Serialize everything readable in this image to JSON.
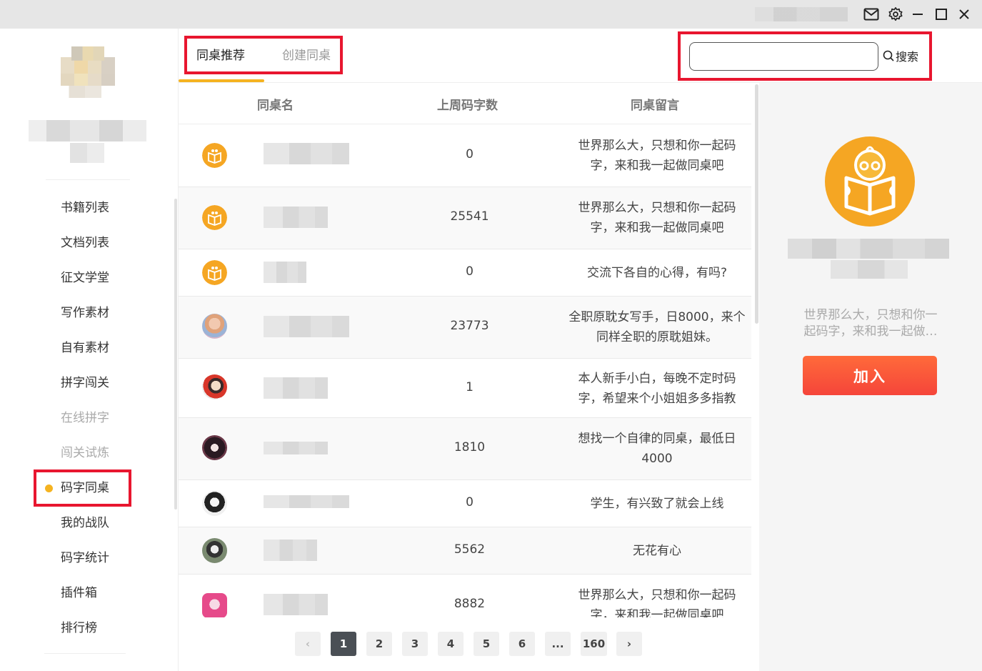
{
  "sidebar": {
    "items": [
      {
        "label": "书籍列表"
      },
      {
        "label": "文档列表"
      },
      {
        "label": "征文学堂"
      },
      {
        "label": "写作素材"
      },
      {
        "label": "自有素材"
      },
      {
        "label": "拼字闯关"
      },
      {
        "label": "在线拼字"
      },
      {
        "label": "闯关试炼"
      },
      {
        "label": "码字同桌"
      },
      {
        "label": "我的战队"
      },
      {
        "label": "码字统计"
      },
      {
        "label": "插件箱"
      },
      {
        "label": "排行榜"
      }
    ]
  },
  "tabs": {
    "recommend": "同桌推荐",
    "create": "创建同桌"
  },
  "search": {
    "value": "",
    "button_label": "搜索"
  },
  "table": {
    "headers": {
      "name": "同桌名",
      "count": "上周码字数",
      "message": "同桌留言"
    },
    "rows": [
      {
        "count": "0",
        "message": "世界那么大，只想和你一起码字，来和我一起做同桌吧",
        "avatar": "default-mascot"
      },
      {
        "count": "25541",
        "message": "世界那么大，只想和你一起码字，来和我一起做同桌吧",
        "avatar": "default-mascot"
      },
      {
        "count": "0",
        "message": "交流下各自的心得，有吗?",
        "avatar": "default-mascot"
      },
      {
        "count": "23773",
        "message": "全职原耽女写手，日8000，来个同样全职的原耽姐妹。",
        "avatar": "user"
      },
      {
        "count": "1",
        "message": "本人新手小白，每晚不定时码字，希望来个小姐姐多多指教",
        "avatar": "user"
      },
      {
        "count": "1810",
        "message": "想找一个自律的同桌，最低日4000",
        "avatar": "user"
      },
      {
        "count": "0",
        "message": "学生，有兴致了就会上线",
        "avatar": "user"
      },
      {
        "count": "5562",
        "message": "无花有心",
        "avatar": "user"
      },
      {
        "count": "8882",
        "message": "世界那么大，只想和你一起码字，来和我一起做同桌吧",
        "avatar": "user"
      }
    ]
  },
  "pagination": {
    "prev": "‹",
    "next": "›",
    "pages": [
      "1",
      "2",
      "3",
      "4",
      "5",
      "6",
      "...",
      "160"
    ],
    "current": "1"
  },
  "right_panel": {
    "message": "世界那么大，只想和你一起码字，来和我一起做同桌吧",
    "join_label": "加入"
  },
  "colors": {
    "accent": "#f5b320",
    "join": "#f5453a",
    "highlight_box": "#e8162f"
  }
}
